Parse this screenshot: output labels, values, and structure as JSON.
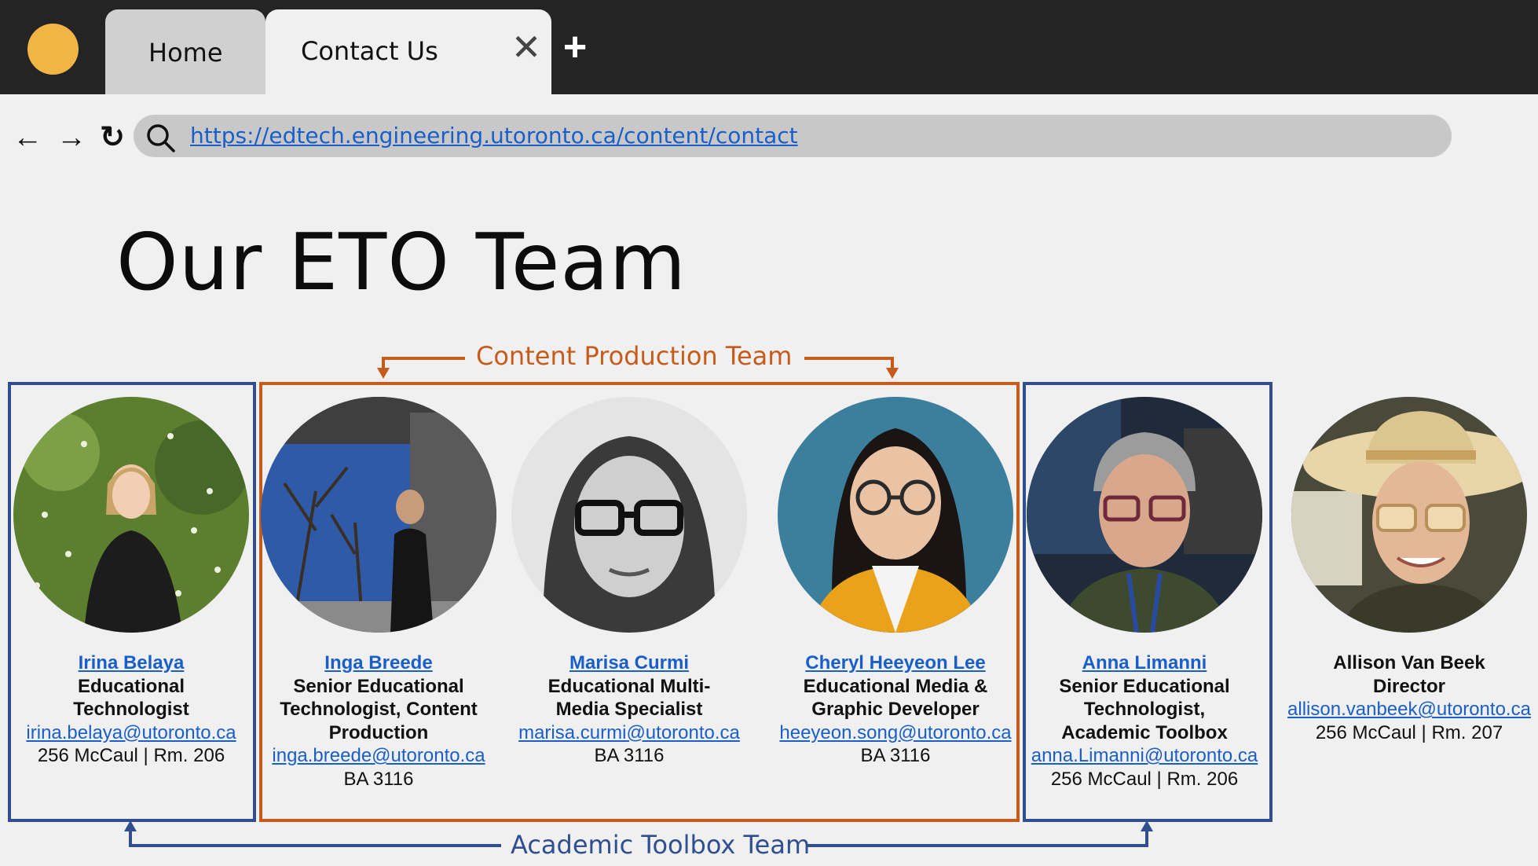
{
  "browser": {
    "tabs": [
      {
        "label": "Home"
      },
      {
        "label": "Contact Us"
      }
    ],
    "close_icon": "close-icon",
    "new_tab_icon": "plus-icon",
    "nav": {
      "back": "←",
      "forward": "→",
      "reload": "↻"
    },
    "url": "https://edtech.engineering.utoronto.ca/content/contact",
    "accent_color": "#f0b544"
  },
  "page": {
    "title": "Our ETO Team",
    "content_team_label": "Content Production Team",
    "toolbox_team_label": "Academic Toolbox Team",
    "colors": {
      "content_team": "#c65c1c",
      "toolbox_team": "#2f4f8f",
      "link": "#1a5fc9"
    }
  },
  "members": [
    {
      "name": "Irina Belaya",
      "title": [
        "Educational",
        "Technologist"
      ],
      "email": "irina.belaya@utoronto.ca",
      "room": "256 McCaul | Rm. 206"
    },
    {
      "name": "Inga Breede",
      "title": [
        "Senior Educational",
        "Technologist, Content",
        "Production"
      ],
      "email": "inga.breede@utoronto.ca",
      "room": "BA 3116"
    },
    {
      "name": "Marisa Curmi",
      "title": [
        "Educational Multi-",
        "Media Specialist"
      ],
      "email": "marisa.curmi@utoronto.ca",
      "room": "BA 3116"
    },
    {
      "name": "Cheryl Heeyeon Lee",
      "title": [
        "Educational Media &",
        "Graphic Developer"
      ],
      "email": "heeyeon.song@utoronto.ca",
      "room": "BA 3116"
    },
    {
      "name": "Anna Limanni",
      "title": [
        "Senior Educational",
        "Technologist,",
        "Academic Toolbox"
      ],
      "email": "anna.Limanni@utoronto.ca",
      "room": "256 McCaul | Rm. 206"
    },
    {
      "name": "Allison Van Beek",
      "title": [
        "Director"
      ],
      "email": "allison.vanbeek@utoronto.ca",
      "room": "256 McCaul | Rm. 207"
    }
  ]
}
